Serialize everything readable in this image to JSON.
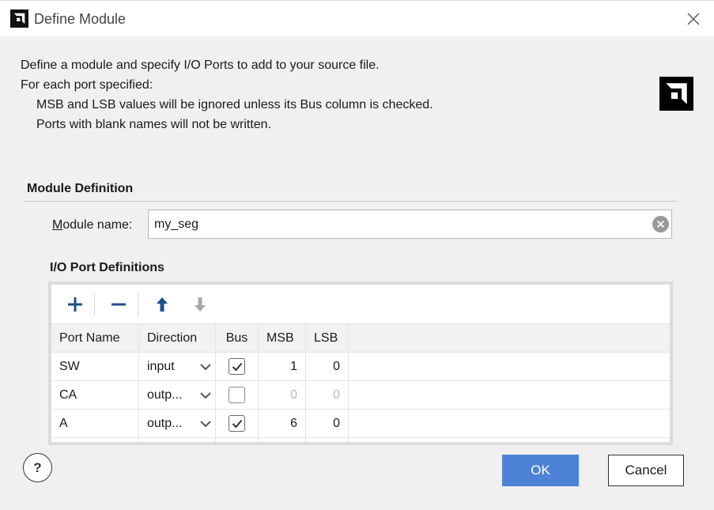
{
  "window": {
    "title": "Define Module",
    "logo_icon": "amd-logo-icon",
    "close_icon": "close-icon"
  },
  "description": {
    "line1": "Define a module and specify I/O Ports to add to your source file.",
    "line2": "For each port specified:",
    "line3": "MSB and LSB values will be ignored unless its Bus column is checked.",
    "line4": "Ports with blank names will not be written."
  },
  "module_definition": {
    "section_title": "Module Definition",
    "name_label_mnemonic": "M",
    "name_label_rest": "odule name:",
    "name_value": "my_seg"
  },
  "io_ports": {
    "section_title": "I/O Port Definitions",
    "toolbar": {
      "add_icon": "plus-icon",
      "remove_icon": "minus-icon",
      "up_icon": "arrow-up-icon",
      "down_icon": "arrow-down-icon"
    },
    "columns": [
      "Port Name",
      "Direction",
      "Bus",
      "MSB",
      "LSB"
    ],
    "rows": [
      {
        "name": "SW",
        "direction": "input",
        "bus": true,
        "msb": "1",
        "lsb": "0"
      },
      {
        "name": "CA",
        "direction": "outp...",
        "bus": false,
        "msb": "0",
        "lsb": "0"
      },
      {
        "name": "A",
        "direction": "outp...",
        "bus": true,
        "msb": "6",
        "lsb": "0"
      }
    ]
  },
  "footer": {
    "help_label": "?",
    "ok_label": "OK",
    "cancel_label": "Cancel"
  },
  "colors": {
    "accent": "#4e82d6",
    "background": "#f0f0f0"
  }
}
